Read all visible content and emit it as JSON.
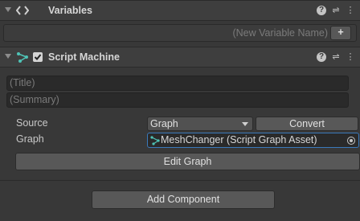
{
  "variables_section": {
    "title": "Variables",
    "new_variable_placeholder": "(New Variable Name)",
    "add_label": "+"
  },
  "script_machine": {
    "title": "Script Machine",
    "enabled": true,
    "title_placeholder": "(Title)",
    "summary_placeholder": "(Summary)",
    "source_label": "Source",
    "source_value": "Graph",
    "convert_label": "Convert",
    "graph_label": "Graph",
    "graph_value": "MeshChanger (Script Graph Asset)",
    "edit_graph_label": "Edit Graph"
  },
  "add_component_label": "Add Component",
  "colors": {
    "accent": "#3a79bb",
    "graph_icon": "#4fc3b6"
  }
}
